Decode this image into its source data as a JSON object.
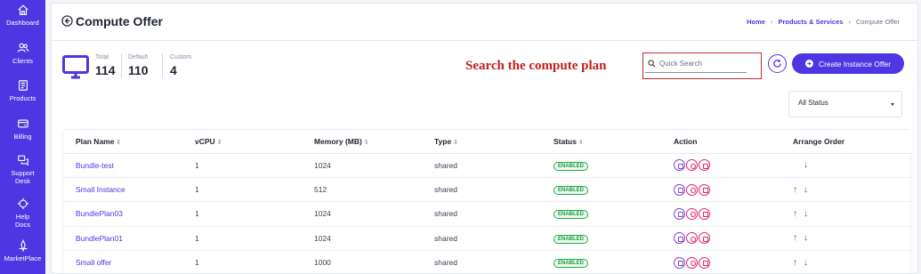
{
  "sidebar": {
    "items": [
      {
        "label": "Dashboard",
        "icon": "home-icon"
      },
      {
        "label": "Clients",
        "icon": "users-icon"
      },
      {
        "label": "Products",
        "icon": "products-icon"
      },
      {
        "label": "Billing",
        "icon": "billing-icon"
      },
      {
        "label": "Support Desk",
        "icon": "support-icon"
      },
      {
        "label": "Help Docs",
        "icon": "help-icon"
      },
      {
        "label": "MarketPlace",
        "icon": "marketplace-icon"
      }
    ],
    "color": "#4e36e2"
  },
  "header": {
    "title": "Compute Offer",
    "breadcrumb": [
      "Home",
      "Products & Services",
      "Compute Offer"
    ]
  },
  "stats": [
    {
      "label": "Total",
      "value": "114"
    },
    {
      "label": "Default",
      "value": "110"
    },
    {
      "label": "Custom",
      "value": "4"
    }
  ],
  "annotation": "Search the compute plan",
  "search": {
    "placeholder": "Quick Search",
    "value": ""
  },
  "create_button": "Create Instance Offer",
  "status_filter": "All Status",
  "table": {
    "headers": [
      "Plan Name",
      "vCPU",
      "Memory (MB)",
      "Type",
      "Status",
      "Action",
      "Arrange Order"
    ],
    "rows": [
      {
        "plan": "Bundle-test",
        "vcpu": "1",
        "memory": "1024",
        "type": "shared",
        "status": "ENABLED",
        "order": [
          "down"
        ]
      },
      {
        "plan": "Small Instance",
        "vcpu": "1",
        "memory": "512",
        "type": "shared",
        "status": "ENABLED",
        "order": [
          "up",
          "down"
        ]
      },
      {
        "plan": "BundlePlan03",
        "vcpu": "1",
        "memory": "1024",
        "type": "shared",
        "status": "ENABLED",
        "order": [
          "up",
          "down"
        ]
      },
      {
        "plan": "BundlePlan01",
        "vcpu": "1",
        "memory": "1024",
        "type": "shared",
        "status": "ENABLED",
        "order": [
          "up",
          "down"
        ]
      },
      {
        "plan": "Small offer",
        "vcpu": "1",
        "memory": "1000",
        "type": "shared",
        "status": "ENABLED",
        "order": [
          "up",
          "down"
        ]
      }
    ]
  },
  "colors": {
    "accent": "#4e36e2",
    "enabled": "#1fae48",
    "annotation": "#c01f1f"
  }
}
